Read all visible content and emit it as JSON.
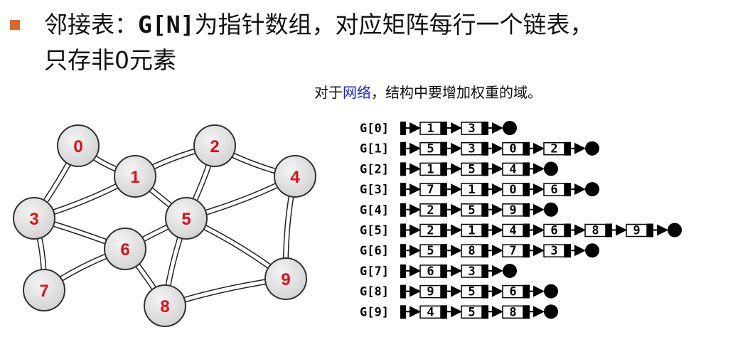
{
  "title": {
    "part1": "邻接表：",
    "part2": "G[N]",
    "part3": "为指针数组，对应矩阵每行一个链表，",
    "line2": "只存非0元素"
  },
  "note": {
    "before": "对于",
    "highlight": "网络",
    "after": "，结构中要增加权重的域。"
  },
  "colors": {
    "bullet": "#d9692a",
    "highlight": "#2222dd",
    "vertex_label": "#e0101a",
    "vertex_fill": "#d4d4d4"
  },
  "graph": {
    "vertices": [
      "0",
      "1",
      "2",
      "3",
      "4",
      "5",
      "6",
      "7",
      "8",
      "9"
    ],
    "edges": [
      [
        0,
        1
      ],
      [
        0,
        3
      ],
      [
        1,
        2
      ],
      [
        1,
        3
      ],
      [
        1,
        5
      ],
      [
        2,
        5
      ],
      [
        2,
        4
      ],
      [
        3,
        7
      ],
      [
        3,
        6
      ],
      [
        4,
        5
      ],
      [
        4,
        9
      ],
      [
        5,
        6
      ],
      [
        5,
        8
      ],
      [
        5,
        9
      ],
      [
        6,
        7
      ],
      [
        6,
        8
      ],
      [
        8,
        9
      ]
    ]
  },
  "adjacency_list": [
    {
      "label": "G[0]",
      "nodes": [
        "1",
        "3"
      ]
    },
    {
      "label": "G[1]",
      "nodes": [
        "5",
        "3",
        "0",
        "2"
      ]
    },
    {
      "label": "G[2]",
      "nodes": [
        "1",
        "5",
        "4"
      ]
    },
    {
      "label": "G[3]",
      "nodes": [
        "7",
        "1",
        "0",
        "6"
      ]
    },
    {
      "label": "G[4]",
      "nodes": [
        "2",
        "5",
        "9"
      ]
    },
    {
      "label": "G[5]",
      "nodes": [
        "2",
        "1",
        "4",
        "6",
        "8",
        "9"
      ]
    },
    {
      "label": "G[6]",
      "nodes": [
        "5",
        "8",
        "7",
        "3"
      ]
    },
    {
      "label": "G[7]",
      "nodes": [
        "6",
        "3"
      ]
    },
    {
      "label": "G[8]",
      "nodes": [
        "9",
        "5",
        "6"
      ]
    },
    {
      "label": "G[9]",
      "nodes": [
        "4",
        "5",
        "8"
      ]
    }
  ]
}
